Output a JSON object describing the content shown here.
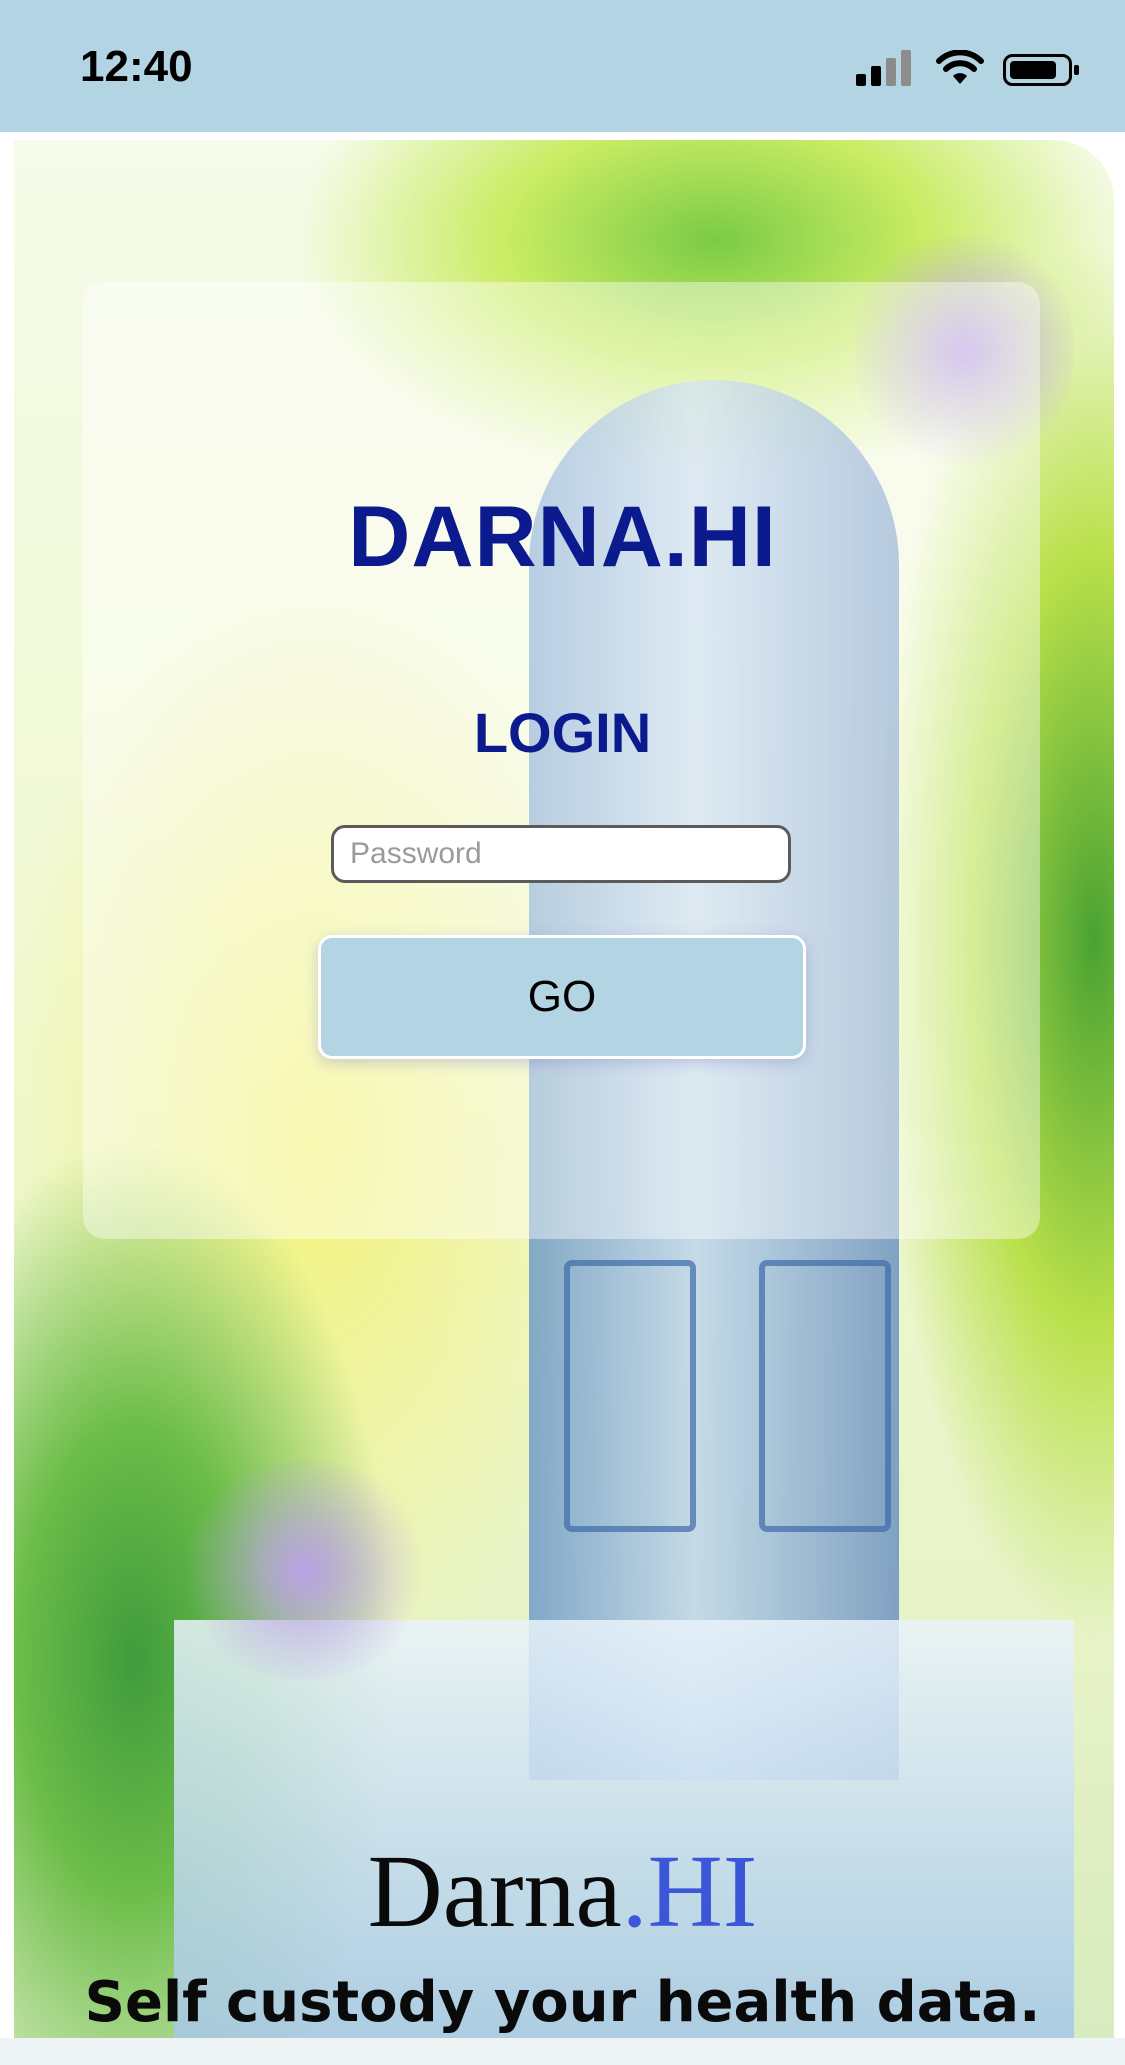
{
  "status_bar": {
    "time": "12:40",
    "icons": [
      "signal-icon",
      "wifi-icon",
      "battery-icon"
    ],
    "background": "#b3d4e3"
  },
  "login_card": {
    "app_title": "DARNA.HI",
    "heading": "LOGIN",
    "password_placeholder": "Password",
    "password_value": "",
    "go_label": "GO"
  },
  "branding": {
    "logo_part1": "Darna",
    "logo_part2": ".HI",
    "tagline": "Self custody your health data."
  },
  "colors": {
    "title": "#0b1a8c",
    "button": "#b3d4e3",
    "logo_accent": "#3b56d6"
  }
}
